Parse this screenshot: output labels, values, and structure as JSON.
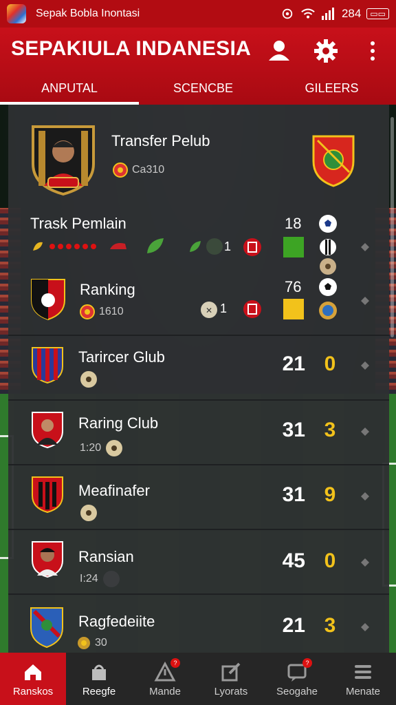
{
  "status_bar": {
    "app_title": "Sepak Bobla Inontasi",
    "time": "284"
  },
  "app_bar": {
    "title": "SEPAKIULA INDANESIA",
    "tabs": [
      {
        "label": "ANPUTAL",
        "active": true
      },
      {
        "label": "SCENCBE",
        "active": false
      },
      {
        "label": "GILEERS",
        "active": false
      }
    ]
  },
  "featured": {
    "title": "Transfer Pelub",
    "value": "Ca310"
  },
  "track": {
    "title": "Trask Pemlain",
    "count_a": "18",
    "count_b": "1"
  },
  "ranking": {
    "title": "Ranking",
    "sub": "1610",
    "count_a": "76",
    "count_b": "1"
  },
  "matches": [
    {
      "name": "Tarircer Glub",
      "sub": "",
      "score_a": "21",
      "score_b": "0"
    },
    {
      "name": "Raring Club",
      "sub": "1:20",
      "score_a": "31",
      "score_b": "3"
    },
    {
      "name": "Meafinafer",
      "sub": "",
      "score_a": "31",
      "score_b": "9"
    },
    {
      "name": "Ransian",
      "sub": "I:24",
      "score_a": "45",
      "score_b": "0"
    },
    {
      "name": "Ragfedeiite",
      "sub": "30",
      "score_a": "21",
      "score_b": "3"
    }
  ],
  "bottom_nav": [
    {
      "label": "Ranskos",
      "icon": "home-icon",
      "active": true
    },
    {
      "label": "Reegfe",
      "icon": "shop-icon",
      "active": false
    },
    {
      "label": "Mande",
      "icon": "alert-icon",
      "active": false
    },
    {
      "label": "Lyorats",
      "icon": "edit-icon",
      "active": false
    },
    {
      "label": "Seogahe",
      "icon": "chat-icon",
      "active": false
    },
    {
      "label": "Menate",
      "icon": "menu-icon",
      "active": false
    }
  ],
  "colors": {
    "brand_red": "#c8101a",
    "score_yellow": "#f2c21b",
    "panel": "#2e3032"
  }
}
